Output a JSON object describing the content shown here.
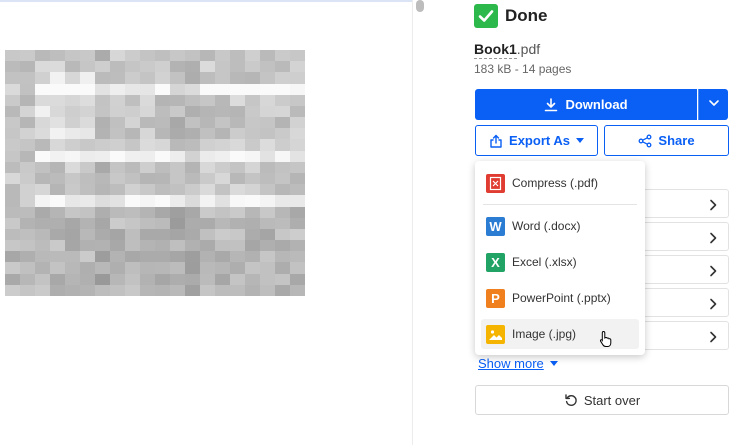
{
  "status": {
    "title": "Done"
  },
  "file": {
    "base_name": "Book1",
    "extension": ".pdf",
    "meta": "183 kB - 14 pages"
  },
  "actions": {
    "download_label": "Download",
    "export_label": "Export As",
    "share_label": "Share",
    "show_more_label": "Show more",
    "start_over_label": "Start over"
  },
  "export_menu": {
    "items": [
      {
        "label": "Compress (.pdf)",
        "icon": "pdf-compress-icon",
        "color": "#e03c31"
      },
      {
        "label": "Word (.docx)",
        "icon": "word-icon",
        "color": "#2b7cd3",
        "glyph": "W"
      },
      {
        "label": "Excel (.xlsx)",
        "icon": "excel-icon",
        "color": "#21a366",
        "glyph": "X"
      },
      {
        "label": "PowerPoint (.pptx)",
        "icon": "powerpoint-icon",
        "color": "#f07f1e",
        "glyph": "P"
      },
      {
        "label": "Image (.jpg)",
        "icon": "image-icon",
        "color": "#f5b400"
      }
    ]
  },
  "colors": {
    "accent": "#0a5ff4",
    "success": "#2db84b"
  }
}
